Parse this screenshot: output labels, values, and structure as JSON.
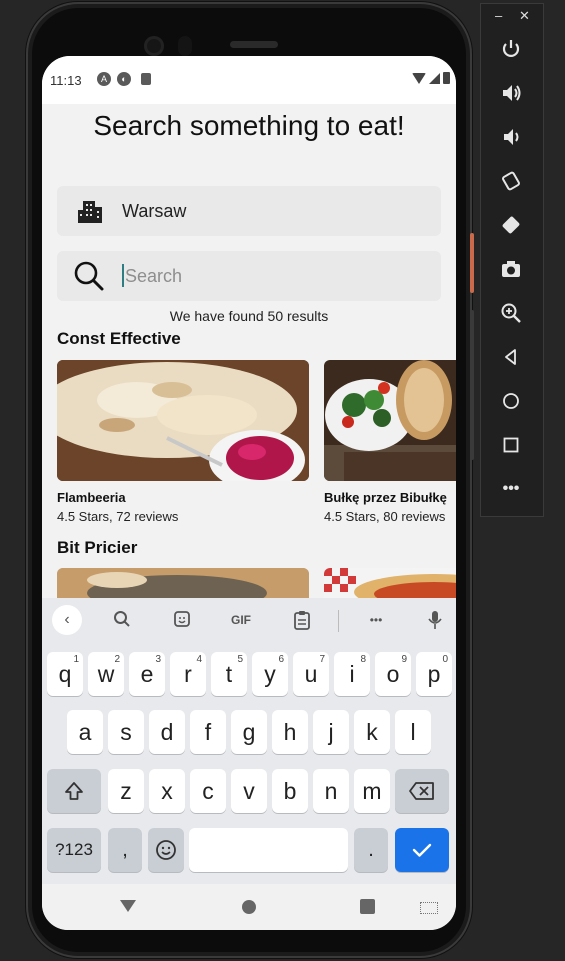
{
  "status": {
    "time": "11:13"
  },
  "header": {
    "title": "Search something to eat!"
  },
  "city": {
    "value": "Warsaw"
  },
  "search": {
    "placeholder": "Search"
  },
  "results": {
    "text": "We have found 50 results"
  },
  "sections": [
    {
      "title": "Const Effective",
      "items": [
        {
          "name": "Flambeeria",
          "meta": "4.5 Stars, 72 reviews"
        },
        {
          "name": "Bułkę przez Bibułkę",
          "meta": "4.5 Stars, 80 reviews"
        }
      ]
    },
    {
      "title": "Bit Pricier"
    }
  ],
  "keyboard": {
    "toolbar": {
      "gif": "GIF",
      "more": "•••"
    },
    "row1": [
      "q",
      "w",
      "e",
      "r",
      "t",
      "y",
      "u",
      "i",
      "o",
      "p"
    ],
    "row1_hints": [
      "1",
      "2",
      "3",
      "4",
      "5",
      "6",
      "7",
      "8",
      "9",
      "0"
    ],
    "row2": [
      "a",
      "s",
      "d",
      "f",
      "g",
      "h",
      "j",
      "k",
      "l"
    ],
    "row3": [
      "z",
      "x",
      "c",
      "v",
      "b",
      "n",
      "m"
    ],
    "symbols_label": "?123",
    "comma": ",",
    "period": "."
  },
  "colors": {
    "accent": "#1a73e8",
    "background": "#f2f2f2",
    "field": "#e9e9e9"
  }
}
